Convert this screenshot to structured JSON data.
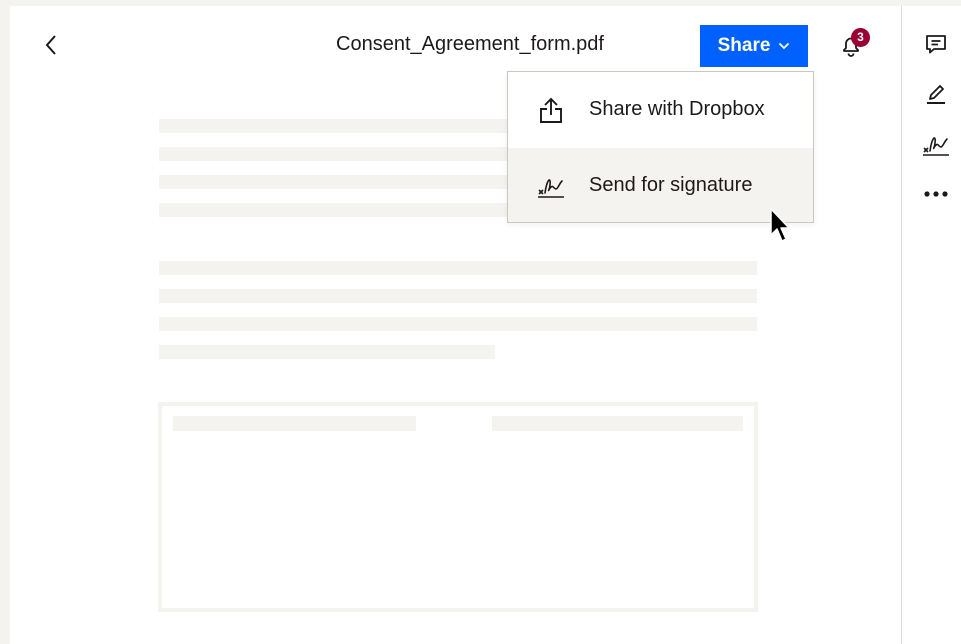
{
  "header": {
    "back_icon": "chevron-left-icon",
    "file_name": "Consent_Agreement_form.pdf",
    "share_label": "Share",
    "share_icon": "chevron-down-icon",
    "notifications": {
      "icon": "bell-icon",
      "count": "3"
    }
  },
  "share_menu": {
    "items": [
      {
        "label": "Share with Dropbox",
        "icon": "share-upload-icon"
      },
      {
        "label": "Send for signature",
        "icon": "signature-icon",
        "hovered": true
      }
    ]
  },
  "right_rail": {
    "icons": [
      "comment-icon",
      "pencil-icon",
      "signature-icon",
      "more-icon"
    ]
  },
  "colors": {
    "accent": "#0061fe",
    "badge": "#9b0032",
    "placeholder": "#f5f3ef",
    "text": "#1e1919"
  }
}
